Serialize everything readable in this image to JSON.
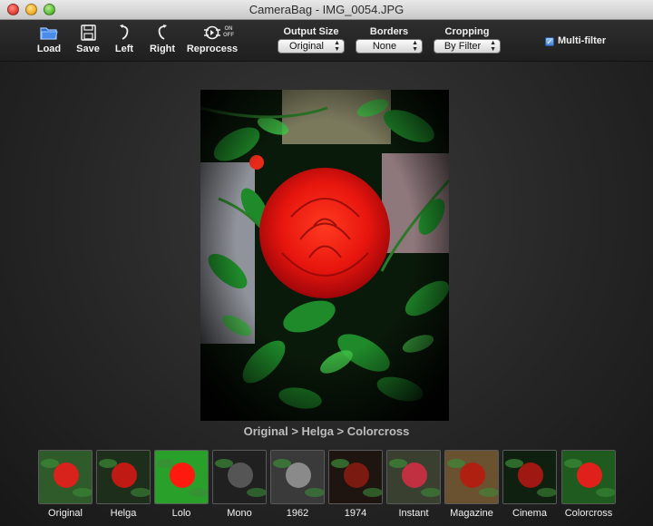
{
  "window": {
    "title": "CameraBag - IMG_0054.JPG"
  },
  "toolbar": {
    "load_label": "Load",
    "save_label": "Save",
    "left_label": "Left",
    "right_label": "Right",
    "reprocess_label": "Reprocess",
    "reprocess_on": "ON",
    "reprocess_off": "OFF",
    "output_size": {
      "label": "Output Size",
      "value": "Original"
    },
    "borders": {
      "label": "Borders",
      "value": "None"
    },
    "cropping": {
      "label": "Cropping",
      "value": "By Filter"
    },
    "multi_filter": {
      "label": "Multi-filter",
      "checked": true
    }
  },
  "main": {
    "filter_path": "Original > Helga > Colorcross"
  },
  "filters": [
    {
      "label": "Original",
      "bg": "#2f5a2a",
      "rose": "#d8221c"
    },
    {
      "label": "Helga",
      "bg": "#1d2e1a",
      "rose": "#c01a14"
    },
    {
      "label": "Lolo",
      "bg": "#29a02a",
      "rose": "#ff1a10"
    },
    {
      "label": "Mono",
      "bg": "#202020",
      "rose": "#555555"
    },
    {
      "label": "1962",
      "bg": "#3a3a3a",
      "rose": "#8a8a8a"
    },
    {
      "label": "1974",
      "bg": "#1e1410",
      "rose": "#7a1a10"
    },
    {
      "label": "Instant",
      "bg": "#3a4030",
      "rose": "#c03040"
    },
    {
      "label": "Magazine",
      "bg": "#6a5230",
      "rose": "#b02010"
    },
    {
      "label": "Cinema",
      "bg": "#102010",
      "rose": "#a01812"
    },
    {
      "label": "Colorcross",
      "bg": "#1f5a1f",
      "rose": "#e0201a"
    }
  ]
}
